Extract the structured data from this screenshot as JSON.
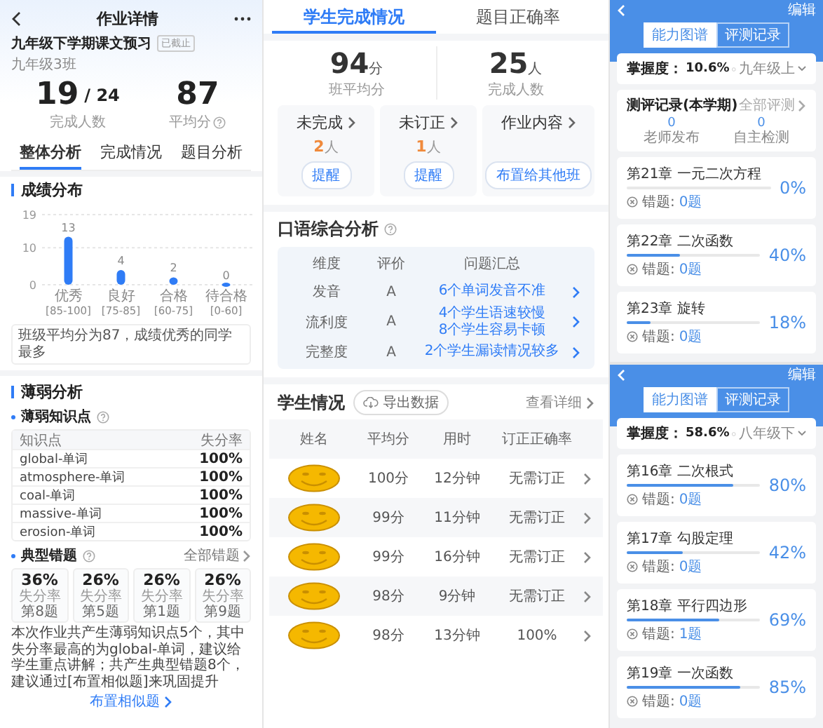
{
  "homework_detail": {
    "title": "作业详情",
    "assignment": {
      "name": "九年级下学期课文预习",
      "tag": "已截止",
      "class_name": "九年级3班"
    },
    "stats": [
      {
        "value": "19",
        "total": "/ 24",
        "label": "完成人数",
        "help": false
      },
      {
        "value": "87",
        "label": "平均分",
        "help": true
      }
    ],
    "tabs": [
      {
        "label": "整体分析",
        "selected": true
      },
      {
        "label": "完成情况",
        "selected": false
      },
      {
        "label": "题目分析",
        "selected": false
      }
    ],
    "score_distribution": {
      "title": "成绩分布",
      "chart_data": {
        "type": "bar",
        "categories": [
          "优秀 [85-100]",
          "良好 [75-85]",
          "合格 [60-75]",
          "待合格 [0-60]"
        ],
        "values": [
          13,
          4,
          2,
          0
        ],
        "ylim": [
          0,
          19
        ],
        "yticks": [
          0,
          10,
          19
        ],
        "data_labels": true
      },
      "summary": "班级平均分为87，成绩优秀的同学最多"
    },
    "weak_analysis": {
      "title": "薄弱分析",
      "knowledge_points": {
        "title": "薄弱知识点",
        "columns": [
          "知识点",
          "失分率"
        ],
        "rows": [
          {
            "point": "global-单词",
            "rate": "100%"
          },
          {
            "point": "atmosphere-单词",
            "rate": "100%"
          },
          {
            "point": "coal-单词",
            "rate": "100%"
          },
          {
            "point": "massive-单词",
            "rate": "100%"
          },
          {
            "point": "erosion-单词",
            "rate": "100%"
          }
        ]
      },
      "typical_errors": {
        "title": "典型错题",
        "link": "全部错题",
        "cards": [
          {
            "rate": "36%",
            "label": "失分率",
            "question": "第8题"
          },
          {
            "rate": "26%",
            "label": "失分率",
            "question": "第5题"
          },
          {
            "rate": "26%",
            "label": "失分率",
            "question": "第1题"
          },
          {
            "rate": "26%",
            "label": "失分率",
            "question": "第9题"
          }
        ]
      },
      "summary": "本次作业共产生薄弱知识点5个，其中失分率最高的为global-单词，建议给学生重点讲解；共产生典型错题8个，建议通过[布置相似题]来巩固提升",
      "button": "布置相似题"
    }
  },
  "completion": {
    "tabs": [
      {
        "label": "学生完成情况",
        "selected": true
      },
      {
        "label": "题目正确率",
        "selected": false
      }
    ],
    "stats": [
      {
        "value": "94",
        "unit": "分",
        "label": "班平均分"
      },
      {
        "value": "25",
        "unit": "人",
        "label": "完成人数"
      }
    ],
    "cards": [
      {
        "kind": "count",
        "title": "未完成",
        "count": "2",
        "unit": "人",
        "button": "提醒"
      },
      {
        "kind": "count",
        "title": "未订正",
        "count": "1",
        "unit": "人",
        "button": "提醒"
      },
      {
        "kind": "action",
        "title": "作业内容",
        "button": "布置给其他班"
      }
    ],
    "oral_analysis": {
      "title": "口语综合分析",
      "columns": [
        "维度",
        "评价",
        "问题汇总"
      ],
      "rows": [
        {
          "dimension": "发音",
          "grade": "A",
          "issue": "6个单词发音不准"
        },
        {
          "dimension": "流利度",
          "grade": "A",
          "issue": "4个学生语速较慢\n8个学生容易卡顿"
        },
        {
          "dimension": "完整度",
          "grade": "A",
          "issue": "2个学生漏读情况较多"
        }
      ]
    },
    "students": {
      "title": "学生情况",
      "export_button": "导出数据",
      "details_link": "查看详细",
      "columns": [
        "姓名",
        "平均分",
        "用时",
        "订正正确率"
      ],
      "rows": [
        {
          "score": "100分",
          "time": "12分钟",
          "correction": "无需订正"
        },
        {
          "score": "99分",
          "time": "11分钟",
          "correction": "无需订正"
        },
        {
          "score": "99分",
          "time": "16分钟",
          "correction": "无需订正"
        },
        {
          "score": "98分",
          "time": "9分钟",
          "correction": "无需订正"
        },
        {
          "score": "98分",
          "time": "13分钟",
          "correction": "100%"
        }
      ]
    }
  },
  "ability_maps": [
    {
      "edit": "编辑",
      "segments": [
        {
          "label": "能力图谱",
          "selected": true
        },
        {
          "label": "评测记录",
          "selected": false
        }
      ],
      "mastery_label": "掌握度：",
      "mastery": "10.6%",
      "grade": "九年级上",
      "records": {
        "title": "测评记录(本学期)",
        "link": "全部评测",
        "items": [
          {
            "value": "0",
            "label": "老师发布"
          },
          {
            "value": "0",
            "label": "自主检测"
          }
        ]
      },
      "chapters": [
        {
          "title": "第21章 一元二次方程",
          "level": 0,
          "rate": "0%",
          "wrong_label": "错题:",
          "wrong": "0题"
        },
        {
          "title": "第22章 二次函数",
          "level": 0.4,
          "rate": "40%",
          "wrong_label": "错题:",
          "wrong": "0题"
        },
        {
          "title": "第23章 旋转",
          "level": 0.18,
          "rate": "18%",
          "wrong_label": "错题:",
          "wrong": "0题"
        }
      ]
    },
    {
      "edit": "编辑",
      "segments": [
        {
          "label": "能力图谱",
          "selected": true
        },
        {
          "label": "评测记录",
          "selected": false
        }
      ],
      "mastery_label": "掌握度：",
      "mastery": "58.6%",
      "grade": "八年级下",
      "chapters": [
        {
          "title": "第16章 二次根式",
          "level": 0.8,
          "rate": "80%",
          "wrong_label": "错题:",
          "wrong": "0题"
        },
        {
          "title": "第17章 勾股定理",
          "level": 0.42,
          "rate": "42%",
          "wrong_label": "错题:",
          "wrong": "0题"
        },
        {
          "title": "第18章 平行四边形",
          "level": 0.69,
          "rate": "69%",
          "wrong_label": "错题:",
          "wrong": "1题"
        },
        {
          "title": "第19章 一次函数",
          "level": 0.85,
          "rate": "85%",
          "wrong_label": "错题:",
          "wrong": "0题"
        }
      ]
    }
  ]
}
